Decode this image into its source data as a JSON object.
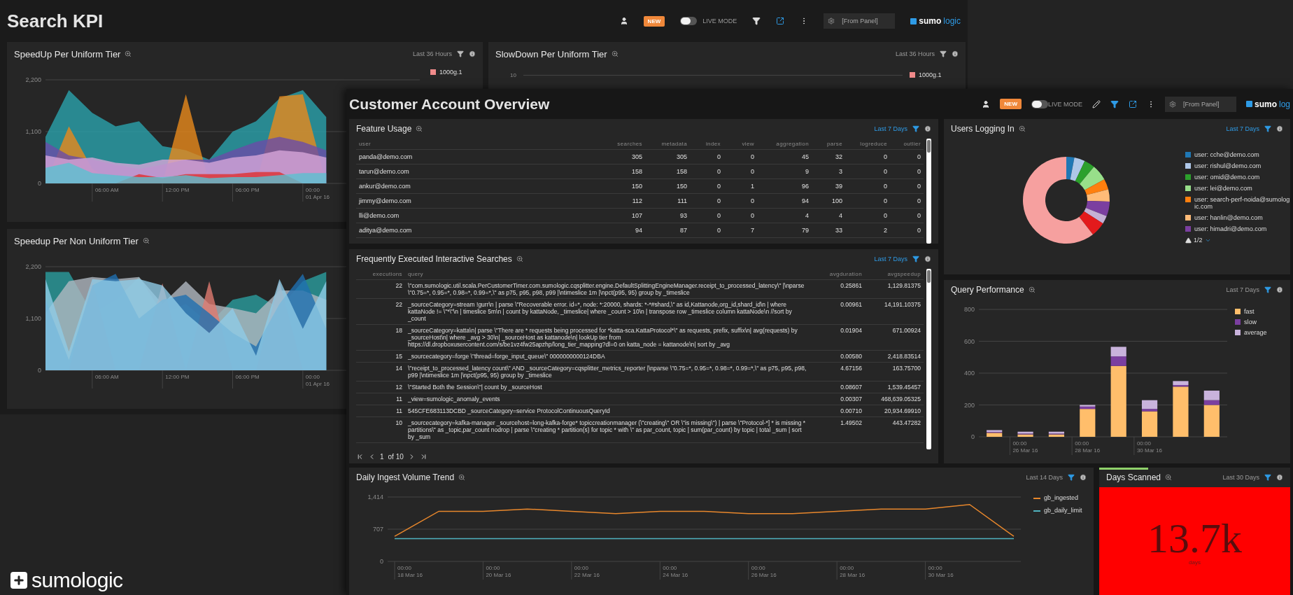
{
  "search_kpi_window": {
    "title": "Search KPI",
    "toolbar": {
      "badge": "NEW",
      "live_mode": {
        "label": "LIVE MODE",
        "on": false
      },
      "tools": [
        {
          "kind": "filter",
          "active": false
        },
        {
          "kind": "share",
          "active": true
        },
        {
          "kind": "more",
          "active": false
        }
      ],
      "field": {
        "value": "[From Panel]"
      },
      "logo": {
        "primary": "sumo",
        "secondary": "logic"
      }
    },
    "speedup_uniform": {
      "title": "SpeedUp Per Uniform Tier",
      "time_range": {
        "label": "Last 36 Hours",
        "active": false
      },
      "legend": [
        {
          "label": "1000g.1",
          "color": "#f08a8a"
        }
      ],
      "y_axis_labels": [
        "2,200",
        "1,100",
        "0"
      ],
      "x_axis_labels": [
        "06:00 AM",
        "12:00 PM",
        "06:00 PM",
        "00:00\n01 Apr 16"
      ]
    },
    "slowdown_uniform": {
      "title": "SlowDown Per Uniform Tier",
      "time_range": {
        "label": "Last 36 Hours",
        "active": false
      },
      "y_tick": "10",
      "legend": [
        {
          "label": "1000g.1",
          "color": "#f08a8a"
        }
      ]
    },
    "speedup_non_uniform": {
      "title": "Speedup Per Non Uniform Tier",
      "y_axis_labels": [
        "2,200",
        "1,100",
        "0"
      ],
      "x_axis_labels": [
        "06:00 AM",
        "12:00 PM",
        "06:00 PM",
        "00:00\n01 Apr 16"
      ]
    }
  },
  "customer_overview_window": {
    "title": "Customer Account Overview",
    "toolbar": {
      "badge": "NEW",
      "live_mode": {
        "label": "LIVE MODE",
        "on": false
      },
      "tools": [
        {
          "kind": "edit",
          "active": false
        },
        {
          "kind": "filter",
          "active": true
        },
        {
          "kind": "share",
          "active": true
        },
        {
          "kind": "more",
          "active": false
        }
      ],
      "field": {
        "value": "[From Panel]"
      },
      "logo": {
        "primary": "sumo",
        "secondary": "log"
      }
    },
    "feature_usage": {
      "title": "Feature Usage",
      "time_range": {
        "label": "Last 7 Days",
        "active": true
      },
      "columns": [
        "user",
        "searches",
        "metadata",
        "index",
        "view",
        "aggregation",
        "parse",
        "logreduce",
        "outlier"
      ],
      "rows": [
        [
          "panda@demo.com",
          "305",
          "305",
          "0",
          "0",
          "45",
          "32",
          "0",
          "0"
        ],
        [
          "tarun@demo.com",
          "158",
          "158",
          "0",
          "0",
          "9",
          "3",
          "0",
          "0"
        ],
        [
          "ankur@demo.com",
          "150",
          "150",
          "0",
          "1",
          "96",
          "39",
          "0",
          "0"
        ],
        [
          "jimmy@demo.com",
          "112",
          "111",
          "0",
          "0",
          "94",
          "100",
          "0",
          "0"
        ],
        [
          "lli@demo.com",
          "107",
          "93",
          "0",
          "0",
          "4",
          "4",
          "0",
          "0"
        ],
        [
          "aditya@demo.com",
          "94",
          "87",
          "0",
          "7",
          "79",
          "33",
          "2",
          "0"
        ]
      ]
    },
    "frequent_searches": {
      "title": "Frequently Executed Interactive Searches",
      "time_range": {
        "label": "Last 7 Days",
        "active": true
      },
      "columns": [
        "executions",
        "query",
        "avgduration",
        "avgspeedup"
      ],
      "rows": [
        [
          "22",
          "\\\"com.sumologic.util.scala.PerCustomerTimer.com.sumologic.cqsplitter.engine.DefaultSplittingEngineManager.receipt_to_processed_latency\\\" |\\nparse \\\"0.75=*, 0.95=*, 0.98=*, 0.99=*,\\\" as p75, p95, p98, p99 |\\ntimeslice 1m |\\npct(p95, 95) group by _timeslice",
          "0.25861",
          "1,129.81375"
        ],
        [
          "22",
          "_sourceCategory=stream !gurr\\n | parse \\\"Recoverable error. id=*, node: *:20000, shards: *-*#shard,\\\" as id,Kattanode,org_id,shard_id\\n | where kattaNode != \\\"*\\\"\\n | timeslice 5m\\n | count by kattaNode, _timeslice| where _count > 10\\n | transpose row _timeslice column kattaNode\\n //sort by _count",
          "0.00961",
          "14,191.10375"
        ],
        [
          "18",
          "_sourceCategory=katta\\n| parse \\\"There are * requests being processed for *katta-sca.KattaProtocol*\\\" as requests, prefix, suffix\\n| avg(requests) by _sourceHost\\n| where _avg > 30\\n| _sourceHost as kattanode\\n| lookUp tier from https://dl.dropboxusercontent.com/s/be1vz4fw25apzhp/long_tier_mapping?dl=0 on katta_node = kattanode\\n| sort by _avg",
          "0.01904",
          "671.00924"
        ],
        [
          "15",
          "_sourcecategory=forge \\\"thread=forge_input_queue\\\" 0000000000124DBA",
          "0.00580",
          "2,418.83514"
        ],
        [
          "14",
          "\\\"receipt_to_processed_latency count\\\" AND _sourceCategory=cqsplitter_metrics_reporter |\\nparse \\\"0.75=*, 0.95=*, 0.98=*, 0.99=*,\\\" as p75, p95, p98, p99 |\\ntimeslice 1m |\\npct(p95, 95) group by _timeslice",
          "4.67156",
          "163.75700"
        ],
        [
          "12",
          "\\\"Started Both the Session\\\"| count by _sourceHost",
          "0.08607",
          "1,539.45457"
        ],
        [
          "11",
          "_view=sumologic_anomaly_events",
          "0.00307",
          "468,639.05325"
        ],
        [
          "11",
          "545CFE683113DCBD _sourceCategory=service ProtocolContinuousQueryId",
          "0.00710",
          "20,934.69910"
        ],
        [
          "10",
          "_sourcecategory=kafka-manager _sourcehost=long-kafka-forge* topiccreationmanager (\\\"creating\\\" OR \\\"is missing\\\") | parse \\\"Protocol-*] * is missing * partitions\\\" as _topic,par_count nodrop | parse \\\"creating * partition(s) for topic * with \\\" as par_count, topic | sum(par_count) by topic | total _sum | sort by _sum",
          "1.49502",
          "443.47282"
        ]
      ],
      "pager": {
        "page": "1",
        "total": "of 10"
      }
    },
    "users_logging_in": {
      "title": "Users Logging In",
      "time_range": {
        "label": "Last 7 Days",
        "active": true
      },
      "legend": [
        {
          "label": "user: cche@demo.com",
          "color": "#1f77b4"
        },
        {
          "label": "user: rishul@demo.com",
          "color": "#aec7e8"
        },
        {
          "label": "user: omid@demo.com",
          "color": "#2ca02c"
        },
        {
          "label": "user: lei@demo.com",
          "color": "#98df8a"
        },
        {
          "label": "user: search-perf-noida@sumologic.com",
          "color": "#ff7f0e"
        },
        {
          "label": "user: hanlin@demo.com",
          "color": "#ffbb78"
        },
        {
          "label": "user: himadri@demo.com",
          "color": "#7b3fa0"
        }
      ],
      "pager": "1/2"
    },
    "query_performance": {
      "title": "Query Performance",
      "time_range": {
        "label": "Last 7 Days",
        "active": false
      },
      "chart_data": {
        "type": "bar",
        "stacked": true,
        "grid": true,
        "orientation": "vertical",
        "categories": [
          null,
          "00:00\n26 Mar 16",
          null,
          "00:00\n28 Mar 16",
          null,
          "00:00\n30 Mar 16",
          null,
          null
        ],
        "ylim": [
          0,
          800
        ],
        "yticks": [
          {
            "value": 0,
            "label": "0"
          },
          {
            "value": 200,
            "label": "200"
          },
          {
            "value": 400,
            "label": "400"
          },
          {
            "value": 600,
            "label": "600"
          },
          {
            "value": 800,
            "label": "800"
          }
        ],
        "series": [
          {
            "name": "fast",
            "color": "#ffbe6b",
            "values": [
              25,
              15,
              15,
              175,
              445,
              160,
              315,
              200
            ]
          },
          {
            "name": "slow",
            "color": "#7b3fa0",
            "values": [
              5,
              5,
              5,
              15,
              60,
              15,
              10,
              30
            ]
          },
          {
            "name": "average",
            "color": "#c9b3dc",
            "values": [
              12,
              12,
              12,
              10,
              60,
              55,
              25,
              60
            ]
          }
        ]
      }
    },
    "daily_ingest": {
      "title": "Daily Ingest Volume Trend",
      "time_range": {
        "label": "Last 14 Days",
        "active": false
      },
      "chart_data": {
        "type": "line",
        "grid": true,
        "categories": [
          "00:00\n18 Mar 16",
          null,
          "00:00\n20 Mar 16",
          null,
          "00:00\n22 Mar 16",
          null,
          "00:00\n24 Mar 16",
          null,
          "00:00\n26 Mar 16",
          null,
          "00:00\n28 Mar 16",
          null,
          "00:00\n30 Mar 16",
          null,
          null
        ],
        "ylim": [
          0,
          1414
        ],
        "yticks": [
          0,
          707,
          {
            "value": 1414,
            "label": "1,414"
          }
        ],
        "series": [
          {
            "name": "gb_ingested",
            "color": "#e8872c",
            "values": [
              550,
              1100,
              1100,
              1150,
              1100,
              1050,
              1100,
              1100,
              1050,
              1050,
              1100,
              1150,
              1150,
              1250,
              550
            ]
          },
          {
            "name": "gb_daily_limit",
            "color": "#4fb3bf",
            "values": [
              500,
              500,
              500,
              500,
              500,
              500,
              500,
              500,
              500,
              500,
              500,
              500,
              500,
              500,
              500
            ]
          }
        ]
      }
    },
    "days_scanned": {
      "title": "Days Scanned",
      "time_range": {
        "label": "Last 30 Days",
        "active": false
      },
      "value": "13.7k",
      "unit": "days"
    }
  },
  "brand_logo": {
    "text": "sumologic"
  }
}
